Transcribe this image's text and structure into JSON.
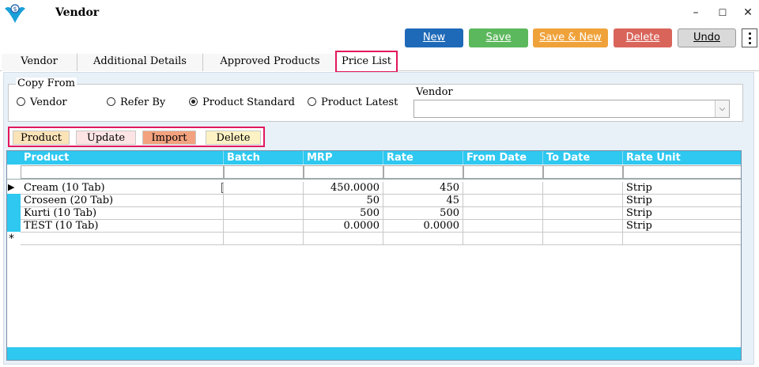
{
  "window": {
    "title": "Vendor",
    "minimize": "–",
    "maximize": "☐",
    "close": "✕"
  },
  "toolbar": {
    "new_label": "New",
    "save_label": "Save",
    "save_new_label": "Save & New",
    "delete_label": "Delete",
    "undo_label": "Undo",
    "colors": {
      "new": "#1e6ab8",
      "save": "#5cb85c",
      "save_new": "#f0a23a",
      "delete": "#d9645a",
      "undo": "#d9d9d9"
    }
  },
  "tabs": [
    {
      "label": "Vendor"
    },
    {
      "label": "Additional Details"
    },
    {
      "label": "Approved Products"
    },
    {
      "label": "Price List",
      "active": true
    }
  ],
  "copy_from": {
    "legend": "Copy From",
    "options": [
      {
        "label": "Vendor",
        "selected": false
      },
      {
        "label": "Refer By",
        "selected": false
      },
      {
        "label": "Product Standard",
        "selected": true
      },
      {
        "label": "Product Latest",
        "selected": false
      }
    ],
    "vendor_label": "Vendor",
    "vendor_value": ""
  },
  "grid_actions": {
    "product": "Product",
    "update": "Update",
    "import": "Import",
    "delete": "Delete"
  },
  "grid": {
    "columns": [
      "Product",
      "Batch",
      "MRP",
      "Rate",
      "From Date",
      "To Date",
      "Rate Unit"
    ],
    "rows": [
      {
        "product": "Cream (10 Tab)",
        "batch": "",
        "mrp": "450.0000",
        "rate": "450",
        "from_date": "",
        "to_date": "",
        "rate_unit": "Strip"
      },
      {
        "product": "Croseen (20 Tab)",
        "batch": "",
        "mrp": "50",
        "rate": "45",
        "from_date": "",
        "to_date": "",
        "rate_unit": "Strip"
      },
      {
        "product": "Kurti (10 Tab)",
        "batch": "",
        "mrp": "500",
        "rate": "500",
        "from_date": "",
        "to_date": "",
        "rate_unit": "Strip"
      },
      {
        "product": "TEST (10 Tab)",
        "batch": "",
        "mrp": "0.0000",
        "rate": "0.0000",
        "from_date": "",
        "to_date": "",
        "rate_unit": "Strip"
      }
    ],
    "current_row_marker": "▶",
    "new_row_marker": "*",
    "accent": "#2ec8f0"
  }
}
